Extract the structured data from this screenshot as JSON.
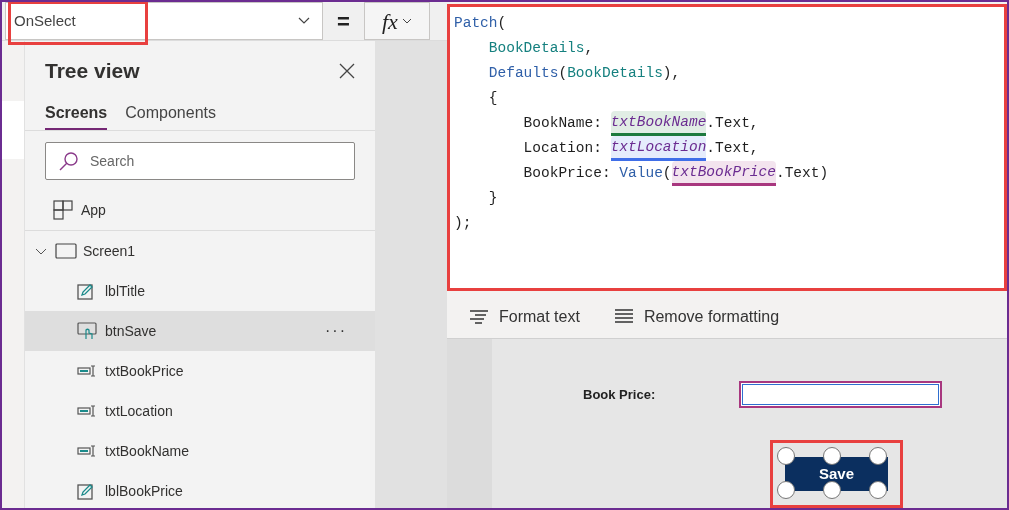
{
  "formula_bar": {
    "property": "OnSelect",
    "equals": "=",
    "fx": "fx"
  },
  "tree_view": {
    "title": "Tree view",
    "tabs": [
      {
        "label": "Screens",
        "selected": true
      },
      {
        "label": "Components",
        "selected": false
      }
    ],
    "search": {
      "placeholder": "Search"
    },
    "items": [
      {
        "label": "App",
        "kind": "app"
      },
      {
        "label": "Screen1",
        "kind": "screen",
        "expanded": true,
        "children": [
          {
            "label": "lblTitle",
            "kind": "label",
            "selected": false
          },
          {
            "label": "btnSave",
            "kind": "button",
            "selected": true,
            "more": "···"
          },
          {
            "label": "txtBookPrice",
            "kind": "textinput",
            "selected": false
          },
          {
            "label": "txtLocation",
            "kind": "textinput",
            "selected": false
          },
          {
            "label": "txtBookName",
            "kind": "textinput",
            "selected": false
          },
          {
            "label": "lblBookPrice",
            "kind": "label",
            "selected": false
          }
        ]
      }
    ]
  },
  "formula": [
    {
      "segments": [
        {
          "text": "Patch",
          "kind": "func"
        },
        {
          "text": "(",
          "kind": "plain"
        }
      ]
    },
    {
      "segments": [
        {
          "text": "    BookDetails",
          "kind": "table"
        },
        {
          "text": ",",
          "kind": "plain"
        }
      ]
    },
    {
      "segments": [
        {
          "text": "    Defaults",
          "kind": "func"
        },
        {
          "text": "(",
          "kind": "plain"
        },
        {
          "text": "BookDetails",
          "kind": "table"
        },
        {
          "text": "),",
          "kind": "plain"
        }
      ]
    },
    {
      "segments": [
        {
          "text": "    {",
          "kind": "plain"
        }
      ]
    },
    {
      "segments": [
        {
          "text": "        BookName: ",
          "kind": "plain"
        },
        {
          "text": "txtBookName",
          "kind": "ref",
          "color": "#1e7a3e"
        },
        {
          "text": ".Text,",
          "kind": "plain"
        }
      ]
    },
    {
      "segments": [
        {
          "text": "        Location: ",
          "kind": "plain"
        },
        {
          "text": "txtLocation",
          "kind": "ref",
          "color": "#3f6ee8"
        },
        {
          "text": ".Text,",
          "kind": "plain"
        }
      ]
    },
    {
      "segments": [
        {
          "text": "        BookPrice: ",
          "kind": "plain"
        },
        {
          "text": "Value",
          "kind": "func"
        },
        {
          "text": "(",
          "kind": "plain"
        },
        {
          "text": "txtBookPrice",
          "kind": "ref",
          "color": "#a8377f"
        },
        {
          "text": ".Text)",
          "kind": "plain"
        }
      ]
    },
    {
      "segments": [
        {
          "text": "    }",
          "kind": "plain"
        }
      ]
    },
    {
      "segments": [
        {
          "text": ");",
          "kind": "plain"
        }
      ]
    }
  ],
  "format_bar": [
    {
      "label": "Format text",
      "kind": "format"
    },
    {
      "label": "Remove formatting",
      "kind": "remove"
    }
  ],
  "canvas": {
    "label": "Book Price:",
    "button": "Save"
  }
}
